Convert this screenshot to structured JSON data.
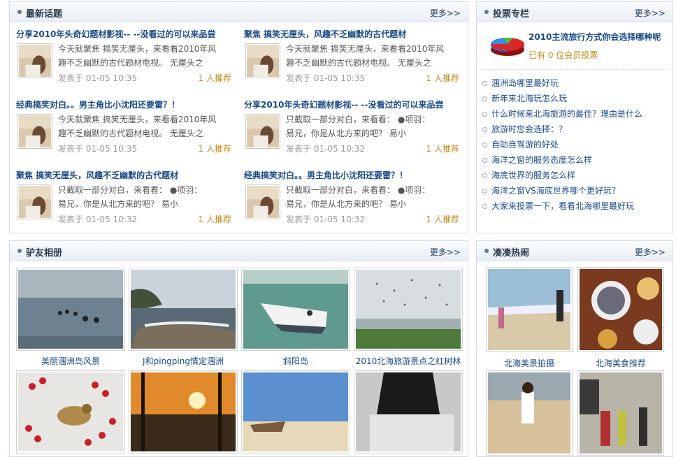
{
  "latest": {
    "title": "最新话题",
    "more": "更多>>",
    "topics": [
      {
        "title": "分享2010年头奇幻题材影视-- --没看过的可以来品尝",
        "line1": "今天就聚焦 搞笑无厘头，来看看2010年风",
        "line2": "趣不乏幽默的古代题材电视。 无厘头之",
        "date": "发表于 01-05 10:35",
        "rec": "1 人推荐"
      },
      {
        "title": "聚焦 搞笑无厘头，风趣不乏幽默的古代题材",
        "line1": "今天就聚焦 搞笑无厘头，来看看2010年风",
        "line2": "趣不乏幽默的古代题材电视。 无厘头之",
        "date": "发表于 01-05 10:35",
        "rec": "1 人推荐"
      },
      {
        "title": "经典搞笑对白。。男主角比小沈阳还要雷？！",
        "line1": "今天就聚焦 搞笑无厘头，来看看2010年风",
        "line2": "趣不乏幽默的古代题材电视。 无厘头之",
        "date": "发表于 01-05 10:35",
        "rec": "1 人推荐"
      },
      {
        "title": "分享2010年头奇幻题材影视-- --没看过的可以来品尝",
        "line1": "只截取一部分对白，来看看：  ●项羽：",
        "line2": "易兄，你是从北方来的吧？    易小",
        "date": "发表于 01-05 10:32",
        "rec": "1 人推荐"
      },
      {
        "title": "聚焦 搞笑无厘头，风趣不乏幽默的古代题材",
        "line1": "只截取一部分对白，来看看：  ●项羽：",
        "line2": "易兄，你是从北方来的吧？    易小",
        "date": "发表于 01-05 10:32",
        "rec": "1 人推荐"
      },
      {
        "title": "经典搞笑对白。。男主角比小沈阳还要雷？！",
        "line1": "只截取一部分对白，来看看：  ●项羽：",
        "line2": "易兄，你是从北方来的吧？    易小",
        "date": "发表于 01-05 10:32",
        "rec": "1 人推荐"
      }
    ]
  },
  "vote": {
    "title": "投票专栏",
    "more": "更多>>",
    "feature_title": "2010主流旅行方式你会选择哪种呢",
    "feature_count": "已有 0 位会员投票",
    "links": [
      "涠洲岛哪里最好玩",
      "新年来北海玩怎么玩",
      "什么时候来北海旅游的最佳？理由是什么",
      "旅游时您会选择：？",
      "自助自驾游的好处",
      "海洋之窗的服务态度怎么样",
      "海底世界的服务怎么样",
      "海洋之窗VS海底世界哪个更好玩？",
      "大家来投票一下，看看北海哪里最好玩"
    ]
  },
  "album": {
    "title": "驴友相册",
    "more": "更多>>",
    "photos": [
      {
        "caption": "美丽涠洲岛风景"
      },
      {
        "caption": "J和pingping情定涠洲"
      },
      {
        "caption": "斜阳岛"
      },
      {
        "caption": "2010北海旅游景点之红树林"
      },
      {
        "caption": ""
      },
      {
        "caption": ""
      },
      {
        "caption": ""
      },
      {
        "caption": ""
      }
    ]
  },
  "hot": {
    "title": "凑凑热闹",
    "more": "更多>>",
    "photos": [
      {
        "caption": "北海美景拍摄"
      },
      {
        "caption": "北海美食推荐"
      },
      {
        "caption": ""
      },
      {
        "caption": ""
      }
    ]
  }
}
